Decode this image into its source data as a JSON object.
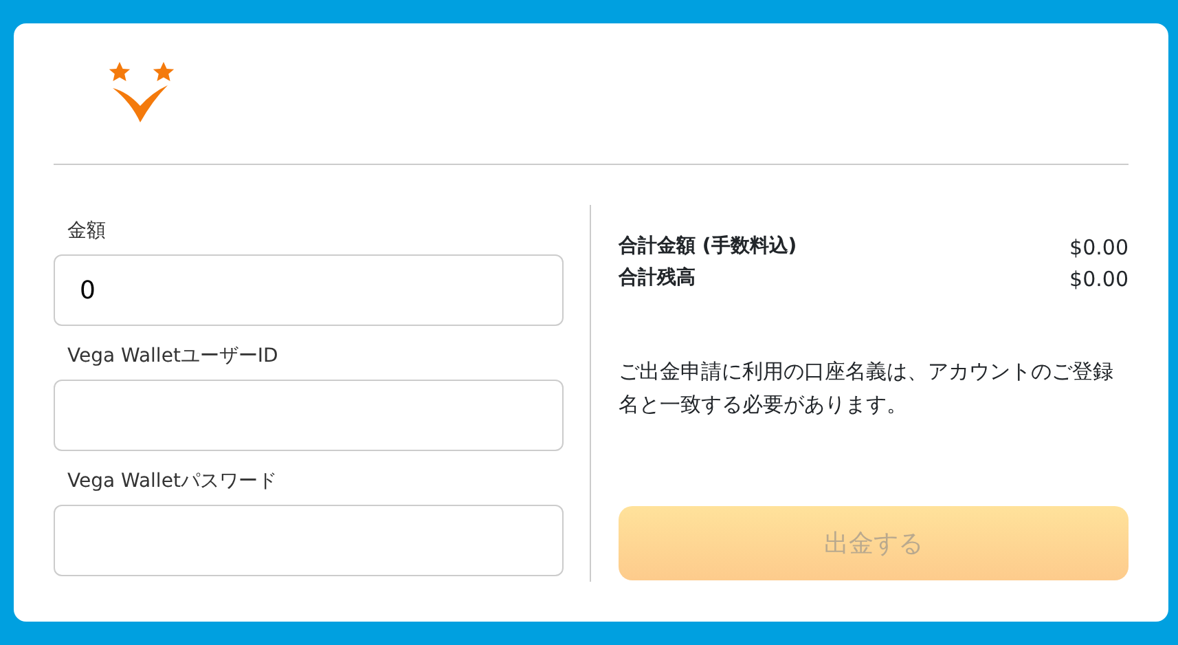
{
  "form": {
    "fields": [
      {
        "label": "金額",
        "value": "0"
      },
      {
        "label": "Vega WalletユーザーID"
      },
      {
        "label": "Vega Walletパスワード"
      }
    ]
  },
  "summary": {
    "rows": [
      {
        "label": "合計金額 (手数料込)",
        "value": "$0.00"
      },
      {
        "label": "合計残高",
        "value": "$0.00"
      }
    ],
    "notice": "ご出金申請に利用の口座名義は、アカウントのご登録名と一致する必要があります。",
    "submit": {
      "label": "出金する",
      "disabled": true
    }
  }
}
